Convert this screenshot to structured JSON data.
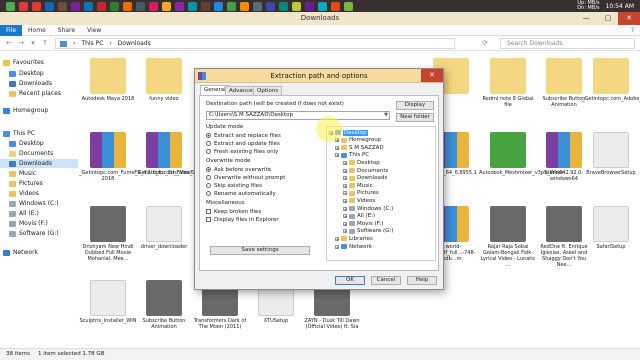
{
  "colors": {
    "accent": "#1979ca",
    "selection": "#cce4f7",
    "dialog_title": "#f5dc9e",
    "close": "#c7432f"
  },
  "taskbar": {
    "icons": [
      "chrome-icon",
      "x-icon",
      "play-icon",
      "app-icon",
      "app-icon",
      "app-icon",
      "app-icon",
      "app-icon",
      "app-icon",
      "app-icon",
      "app-icon",
      "app-icon",
      "folder-icon",
      "app-icon",
      "app-icon",
      "app-icon",
      "app-icon",
      "app-icon",
      "app-icon",
      "app-icon",
      "app-icon",
      "app-icon",
      "app-icon",
      "app-icon",
      "app-icon",
      "app-icon",
      "app-icon"
    ],
    "net_up": "Up: MB/s",
    "net_down": "Dn: MB/s",
    "clock": "10:54 AM"
  },
  "window": {
    "title": "Downloads"
  },
  "ribbon": {
    "tabs": [
      "File",
      "Home",
      "Share",
      "View"
    ]
  },
  "address": {
    "crumbs": [
      "This PC",
      "Downloads"
    ],
    "search_placeholder": "Search Downloads"
  },
  "navpane": {
    "items": [
      {
        "label": "Favourites",
        "icon": "star-icon"
      },
      {
        "label": "Desktop",
        "icon": "desktop-icon"
      },
      {
        "label": "Downloads",
        "icon": "downloads-icon"
      },
      {
        "label": "Recent places",
        "icon": "recent-icon"
      },
      {
        "label": "Homegroup",
        "icon": "homegroup-icon"
      },
      {
        "label": "This PC",
        "icon": "pc-icon"
      },
      {
        "label": "Desktop",
        "icon": "desktop-icon"
      },
      {
        "label": "Documents",
        "icon": "documents-icon"
      },
      {
        "label": "Downloads",
        "icon": "downloads-icon"
      },
      {
        "label": "Music",
        "icon": "music-icon"
      },
      {
        "label": "Pictures",
        "icon": "pictures-icon"
      },
      {
        "label": "Videos",
        "icon": "videos-icon"
      },
      {
        "label": "Windows (C:)",
        "icon": "drive-icon"
      },
      {
        "label": "All (E:)",
        "icon": "drive-icon"
      },
      {
        "label": "Movis (F:)",
        "icon": "drive-icon"
      },
      {
        "label": "Software (G:)",
        "icon": "drive-icon"
      },
      {
        "label": "Network",
        "icon": "network-icon"
      }
    ]
  },
  "files": [
    {
      "name": "Autodesk Maya 2018",
      "kind": "folder"
    },
    {
      "name": "funny video",
      "kind": "folder"
    },
    {
      "name": "",
      "kind": "folder"
    },
    {
      "name": "Redmi note 8 Global file",
      "kind": "folder"
    },
    {
      "name": "Subscribe Button Animation",
      "kind": "folder"
    },
    {
      "name": "_Getintopc.com_Adobe_After_Effects_CC_2018_v15.1.2.69_x64_Mult...",
      "kind": "folder"
    },
    {
      "name": "_Getintopc.com_FumeFX_4.1.0_for_3ds_Max_2013-2018",
      "kind": "winrar"
    },
    {
      "name": "_Getintopc.com_FumeFX.4.Maya.2016.Incl.Arnold.VRay3.0",
      "kind": "winrar"
    },
    {
      "name": "...20H1_64_6.8955.1",
      "kind": "winrar"
    },
    {
      "name": "Autodesk_Meshmixer_v3p5_Win64",
      "kind": "green"
    },
    {
      "name": "blender-2.92.0-windows64",
      "kind": "winrar"
    },
    {
      "name": "BraveBrowserSetup",
      "kind": "doc"
    },
    {
      "name": "Drishyam New Hindi Dubbed Full Movie Mohanlal, Mee...",
      "kind": "video"
    },
    {
      "name": "driver_downloader",
      "kind": "doc"
    },
    {
      "name": "...world-ma...pdf_full...-748-mdb...m",
      "kind": "winrar"
    },
    {
      "name": "Rajar Raja Sobai Golam-Bengali Folk-Lyrical Video - Lunatic ...",
      "kind": "video"
    },
    {
      "name": "RedOne ft. Enrique Iglesias, Aseel and Shaggy Don't You Nee...",
      "kind": "video"
    },
    {
      "name": "SafariSetup",
      "kind": "doc"
    },
    {
      "name": "Sculptris_Installer_WIN",
      "kind": "doc"
    },
    {
      "name": "Subscribe Button Animation",
      "kind": "video"
    },
    {
      "name": "Transformers Dark of The Moon (2011)",
      "kind": "video"
    },
    {
      "name": "XTUSetup",
      "kind": "doc"
    },
    {
      "name": "ZAYN - Dusk Till Dawn (Official Video) ft. Sia",
      "kind": "video"
    }
  ],
  "status": {
    "count": "38 items",
    "selected": "1 item selected  1.78 GB"
  },
  "dialog": {
    "title": "Extraction path and options",
    "tabs": [
      "General",
      "Advanced",
      "Options"
    ],
    "dest_label": "Destination path (will be created if does not exist)",
    "dest_value": "C:\\Users\\S M SAZZAD\\Desktop",
    "display_btn": "Display",
    "newfolder_btn": "New folder",
    "update_mode_label": "Update mode",
    "update_opts": [
      "Extract and replace files",
      "Extract and update files",
      "Fresh existing files only"
    ],
    "overwrite_label": "Overwrite mode",
    "overwrite_opts": [
      "Ask before overwrite",
      "Overwrite without prompt",
      "Skip existing files",
      "Rename automatically"
    ],
    "misc_label": "Miscellaneous",
    "misc_opts": [
      "Keep broken files",
      "Display files in Explorer"
    ],
    "save_btn": "Save settings",
    "ok_btn": "OK",
    "cancel_btn": "Cancel",
    "help_btn": "Help",
    "tree": [
      "Desktop",
      "Homegroup",
      "S M SAZZAD",
      "This PC",
      "Desktop",
      "Documents",
      "Downloads",
      "Music",
      "Pictures",
      "Videos",
      "Windows (C:)",
      "All (E:)",
      "Movis (F:)",
      "Software (G:)",
      "Libraries",
      "Network"
    ]
  }
}
